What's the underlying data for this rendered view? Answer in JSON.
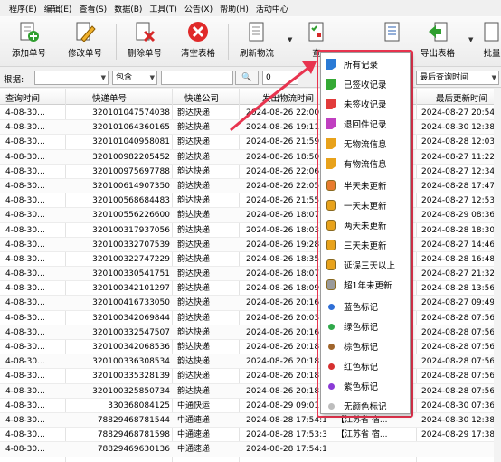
{
  "menu": [
    "程序(E)",
    "编辑(E)",
    "查看(S)",
    "数据(B)",
    "工具(T)",
    "公告(X)",
    "帮助(H)",
    "活动中心"
  ],
  "toolbar": {
    "add": "添加单号",
    "edit": "修改单号",
    "delete": "删除单号",
    "clear": "清空表格",
    "refresh": "刷新物流",
    "query": "查",
    "import": "导出表格",
    "batch": "批量"
  },
  "filter": {
    "by_label": "根据:",
    "contains": "包含",
    "sort_by": "最后查询时间"
  },
  "columns": [
    "查询时间",
    "快递单号",
    "快递公司",
    "发出物流时间",
    "最后更新时间"
  ],
  "rows": [
    {
      "q": "4-08-30...",
      "no": "320101047574038",
      "co": "韵达快递",
      "send": "2024-08-26 22:00",
      "last": "2024-08-27 20:54:"
    },
    {
      "q": "4-08-30...",
      "no": "320101064360165",
      "co": "韵达快递",
      "send": "2024-08-26 19:11",
      "last": "2024-08-30 12:38:"
    },
    {
      "q": "4-08-30...",
      "no": "320101040958081",
      "co": "韵达快递",
      "send": "2024-08-26 21:59",
      "last": "2024-08-28 12:03:"
    },
    {
      "q": "4-08-30...",
      "no": "320100982205452",
      "co": "韵达快递",
      "send": "2024-08-26 18:50",
      "last": "2024-08-27 11:22:"
    },
    {
      "q": "4-08-30...",
      "no": "320100975697788",
      "co": "韵达快递",
      "send": "2024-08-26 22:06",
      "last": "2024-08-27 12:34:"
    },
    {
      "q": "4-08-30...",
      "no": "320100614907350",
      "co": "韵达快递",
      "send": "2024-08-26 22:05",
      "last": "2024-08-28 17:47:"
    },
    {
      "q": "4-08-30...",
      "no": "320100568684483",
      "co": "韵达快递",
      "send": "2024-08-26 21:55",
      "last": "2024-08-27 12:53:"
    },
    {
      "q": "4-08-30...",
      "no": "320100556226600",
      "co": "韵达快递",
      "send": "2024-08-26 18:07",
      "last": "2024-08-29 08:36:"
    },
    {
      "q": "4-08-30...",
      "no": "320100317937056",
      "co": "韵达快递",
      "send": "2024-08-26 18:03",
      "last": "2024-08-28 18:30:"
    },
    {
      "q": "4-08-30...",
      "no": "320100332707539",
      "co": "韵达快递",
      "send": "2024-08-26 19:28",
      "last": "2024-08-27 14:46:"
    },
    {
      "q": "4-08-30...",
      "no": "320100322747229",
      "co": "韵达快递",
      "send": "2024-08-26 18:35",
      "last": "2024-08-28 16:48:"
    },
    {
      "q": "4-08-30...",
      "no": "320100330541751",
      "co": "韵达快递",
      "send": "2024-08-26 18:07",
      "last": "2024-08-27 21:32:"
    },
    {
      "q": "4-08-30...",
      "no": "320100342101297",
      "co": "韵达快递",
      "send": "2024-08-26 18:09",
      "last": "2024-08-28 13:56:"
    },
    {
      "q": "4-08-30...",
      "no": "320100416733050",
      "co": "韵达快递",
      "send": "2024-08-26 20:16",
      "last": "2024-08-27 09:49:"
    },
    {
      "q": "4-08-30...",
      "no": "320100342069844",
      "co": "韵达快递",
      "send": "2024-08-26 20:03",
      "last": "2024-08-28 07:56:"
    },
    {
      "q": "4-08-30...",
      "no": "320100332547507",
      "co": "韵达快递",
      "send": "2024-08-26 20:16",
      "last": "2024-08-28 07:56:"
    },
    {
      "q": "4-08-30...",
      "no": "320100342068536",
      "co": "韵达快递",
      "send": "2024-08-26 20:18",
      "last": "2024-08-28 07:56:"
    },
    {
      "q": "4-08-30...",
      "no": "320100336308534",
      "co": "韵达快递",
      "send": "2024-08-26 20:18",
      "last": "2024-08-28 07:56:"
    },
    {
      "q": "4-08-30...",
      "no": "320100335328139",
      "co": "韵达快递",
      "send": "2024-08-26 20:18",
      "last": "2024-08-28 07:56:"
    },
    {
      "q": "4-08-30...",
      "no": "320100325850734",
      "co": "韵达快递",
      "send": "2024-08-26 20:18",
      "last": "2024-08-28 07:56:"
    },
    {
      "q": "4-08-30...",
      "no": "330368084125",
      "co": "中通快运",
      "send": "2024-08-29 09:01",
      "last": "2024-08-30 07:36:"
    },
    {
      "q": "4-08-30...",
      "no": "78829468781544",
      "co": "中通速递",
      "send": "2024-08-28 17:54:16",
      "extra": "【江苏省 宿...",
      "last": "2024-08-30 12:38:"
    },
    {
      "q": "4-08-30...",
      "no": "78829468781598",
      "co": "中通速递",
      "send": "2024-08-28 17:53:36",
      "extra": "【江苏省 宿...",
      "last": "2024-08-29 17:38:"
    },
    {
      "q": "4-08-30...",
      "no": "78829469630136",
      "co": "中通速递",
      "send": "2024-08-28 17:54:12",
      "extra": "",
      "last": ""
    }
  ],
  "dropdown": {
    "items": [
      {
        "label": "所有记录",
        "icon": "all-records-icon",
        "color": "#2a7ad5"
      },
      {
        "label": "已签收记录",
        "icon": "signed-icon",
        "color": "#35a935"
      },
      {
        "label": "未签收记录",
        "icon": "unsigned-icon",
        "color": "#e23b3b"
      },
      {
        "label": "退回件记录",
        "icon": "returned-icon",
        "color": "#c03fc0"
      },
      {
        "label": "无物流信息",
        "icon": "no-logistics-icon",
        "color": "#e8a21b"
      },
      {
        "label": "有物流信息",
        "icon": "has-logistics-icon",
        "color": "#e8a21b"
      },
      {
        "label": "半天未更新",
        "icon": "half-day-icon",
        "color": "#e87b2e"
      },
      {
        "label": "一天未更新",
        "icon": "one-day-icon",
        "color": "#e8a21b"
      },
      {
        "label": "两天未更新",
        "icon": "two-day-icon",
        "color": "#e8a21b"
      },
      {
        "label": "三天未更新",
        "icon": "three-day-icon",
        "color": "#e8a21b"
      },
      {
        "label": "延误三天以上",
        "icon": "delay-icon",
        "color": "#e8a21b"
      },
      {
        "label": "超1年未更新",
        "icon": "year-icon",
        "color": "#9a9a9a"
      },
      {
        "label": "蓝色标记",
        "icon": "blue-dot",
        "color": "#2f6fd6"
      },
      {
        "label": "绿色标记",
        "icon": "green-dot",
        "color": "#2fa84a"
      },
      {
        "label": "棕色标记",
        "icon": "brown-dot",
        "color": "#a0652c"
      },
      {
        "label": "红色标记",
        "icon": "red-dot",
        "color": "#d63030"
      },
      {
        "label": "紫色标记",
        "icon": "purple-dot",
        "color": "#8a3ad6"
      },
      {
        "label": "无颜色标记",
        "icon": "none-dot",
        "color": "#bdbdbd"
      }
    ]
  }
}
